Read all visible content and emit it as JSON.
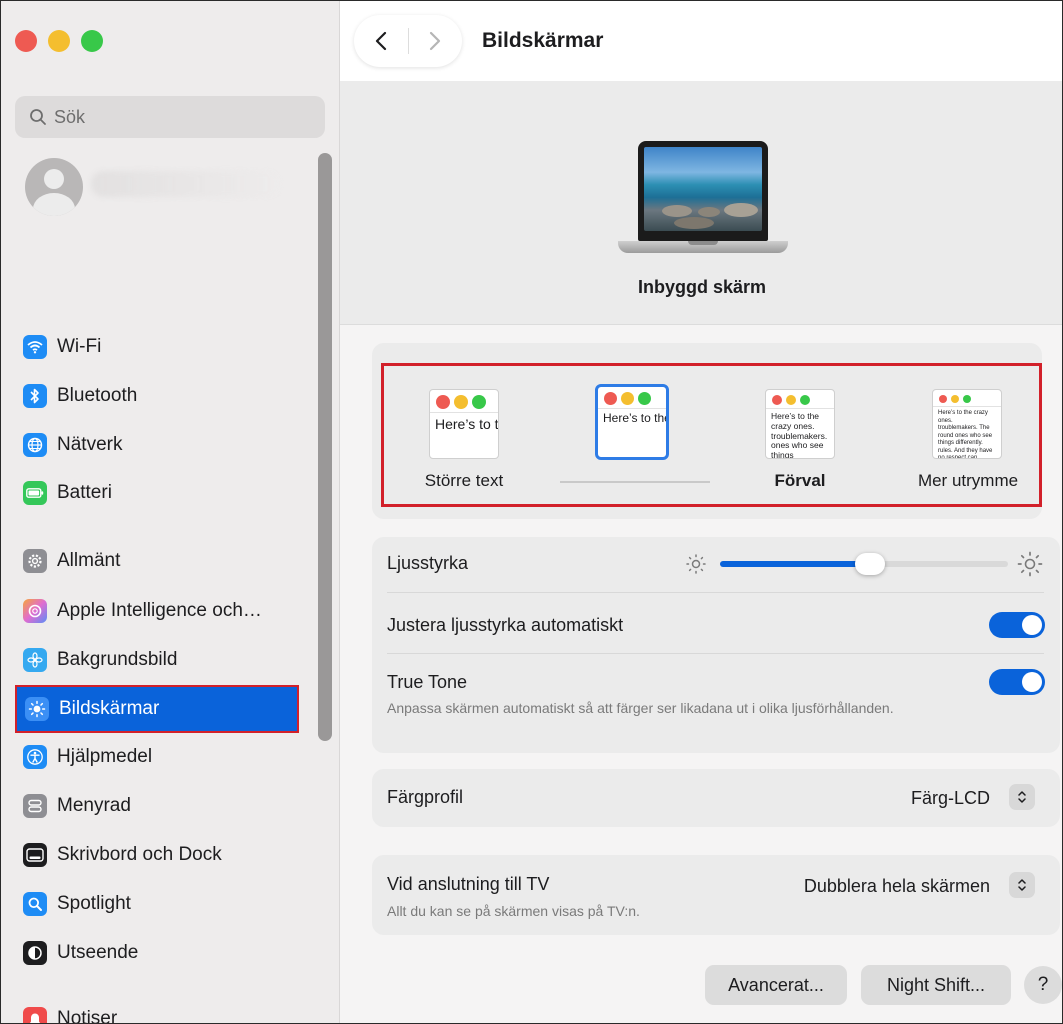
{
  "window": {
    "title": "Bildskärmar"
  },
  "sidebar": {
    "search_placeholder": "Sök",
    "items": [
      {
        "label": "Wi-Fi",
        "icon": "wifi-icon",
        "color": "#1e8cf5"
      },
      {
        "label": "Bluetooth",
        "icon": "bluetooth-icon",
        "color": "#1e8cf5"
      },
      {
        "label": "Nätverk",
        "icon": "globe-icon",
        "color": "#1e8cf5"
      },
      {
        "label": "Batteri",
        "icon": "battery-icon",
        "color": "#34c759"
      },
      {
        "label": "Allmänt",
        "icon": "gear-icon",
        "color": "#8e8e93"
      },
      {
        "label": "Apple Intelligence och…",
        "icon": "apple-intelligence-icon",
        "color": "#e06cd0"
      },
      {
        "label": "Bakgrundsbild",
        "icon": "flower-icon",
        "color": "#35a9f0"
      },
      {
        "label": "Bildskärmar",
        "icon": "sun-icon",
        "color": "#1e8cf5"
      },
      {
        "label": "Hjälpmedel",
        "icon": "accessibility-icon",
        "color": "#1e8cf5"
      },
      {
        "label": "Menyrad",
        "icon": "menubar-icon",
        "color": "#8e8e93"
      },
      {
        "label": "Skrivbord och Dock",
        "icon": "dock-icon",
        "color": "#1d1d1f"
      },
      {
        "label": "Spotlight",
        "icon": "magnifier-icon",
        "color": "#1e8cf5"
      },
      {
        "label": "Utseende",
        "icon": "appearance-icon",
        "color": "#1d1d1f"
      },
      {
        "label": "Notiser",
        "icon": "bell-icon",
        "color": "#f04b4b"
      }
    ],
    "selected": "Bildskärmar"
  },
  "display": {
    "name": "Inbyggd skärm"
  },
  "resolution": {
    "options": [
      {
        "label": "Större text",
        "sample": "Here’s to the troublemakers."
      },
      {
        "label": "",
        "sample": "Here’s to the troublemakers. ones who"
      },
      {
        "label": "Förval",
        "sample": "Here’s to the crazy ones. troublemakers. ones who see things differently. rules. And they"
      },
      {
        "label": "Mer utrymme",
        "sample": "Here’s to the crazy ones. troublemakers. The round ones who see things differently. rules. And they have no respect can quote them, disagree them. About the only thing Because they change things."
      }
    ],
    "selected_index": 1
  },
  "brightness": {
    "label": "Ljusstyrka",
    "value_percent": 52
  },
  "auto_brightness": {
    "label": "Justera ljusstyrka automatiskt",
    "on": true
  },
  "true_tone": {
    "label": "True Tone",
    "description": "Anpassa skärmen automatiskt så att färger ser likadana ut i olika ljusförhållanden.",
    "on": true
  },
  "color_profile": {
    "label": "Färgprofil",
    "value": "Färg-LCD"
  },
  "tv": {
    "label": "Vid anslutning till TV",
    "value": "Dubblera hela skärmen",
    "description": "Allt du kan se på skärmen visas på TV:n."
  },
  "buttons": {
    "advanced": "Avancerat...",
    "night_shift": "Night Shift...",
    "help": "?"
  },
  "colors": {
    "accent": "#0a63da",
    "highlight_outline": "#d2202a"
  }
}
